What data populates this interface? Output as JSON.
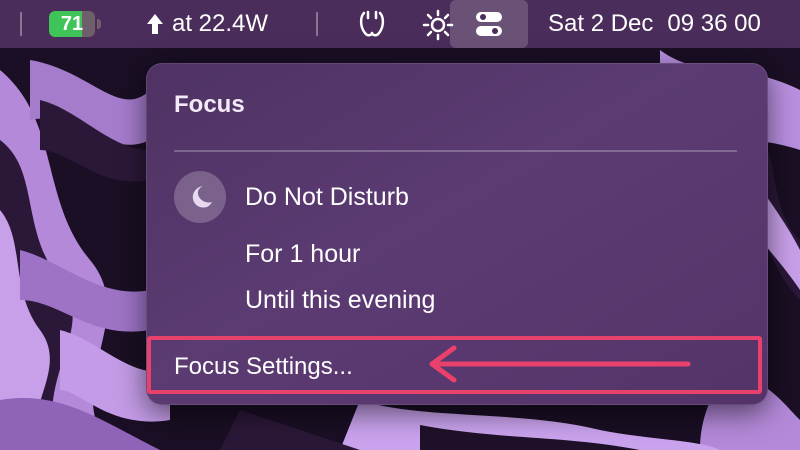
{
  "menubar": {
    "battery": {
      "level_text": "71",
      "level_fraction": 0.71,
      "color": "#3fc45a"
    },
    "charging": {
      "icon": "up-arrow-icon",
      "label": "at 22.4W"
    },
    "icons": [
      "headphones-icon",
      "brightness-icon",
      "control-center-icon"
    ],
    "date": "Sat 2 Dec",
    "time": "09 36 00"
  },
  "focus_menu": {
    "title": "Focus",
    "dnd": {
      "icon": "moon-icon",
      "label": "Do Not Disturb",
      "options": [
        "For 1 hour",
        "Until this evening"
      ]
    },
    "settings_label": "Focus Settings..."
  },
  "annotation": {
    "color": "#e8416b",
    "shapes": [
      "highlight-box",
      "left-arrow"
    ]
  }
}
